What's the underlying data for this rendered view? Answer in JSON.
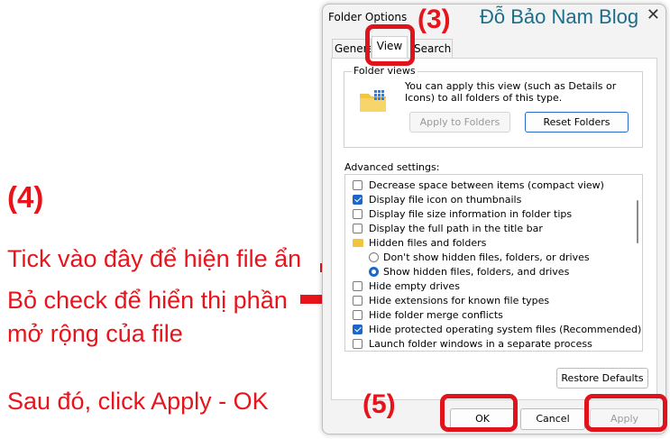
{
  "annotations": {
    "step3": "(3)",
    "step4": "(4)",
    "step5": "(5)",
    "tick": "Tick vào đây để hiện file ẩn",
    "bo_line1": "Bỏ check để hiển thị phần",
    "bo_line2": "mở rộng của file",
    "sau": "Sau đó, click Apply - OK",
    "blog": "Đỗ Bảo Nam Blog"
  },
  "dialog": {
    "title": "Folder Options",
    "close": "✕",
    "tabs": [
      "General",
      "View",
      "Search"
    ],
    "folder_views": {
      "label": "Folder views",
      "text": "You can apply this view (such as Details or Icons) to all folders of this type.",
      "apply_to_folders": "Apply to Folders",
      "reset_folders": "Reset Folders"
    },
    "advanced_label": "Advanced settings:",
    "advanced_items": [
      {
        "label": "Decrease space between items (compact view)",
        "type": "checkbox",
        "checked": false
      },
      {
        "label": "Display file icon on thumbnails",
        "type": "checkbox",
        "checked": true
      },
      {
        "label": "Display file size information in folder tips",
        "type": "checkbox",
        "checked": false
      },
      {
        "label": "Display the full path in the title bar",
        "type": "checkbox",
        "checked": false
      },
      {
        "label": "Hidden files and folders",
        "type": "folder",
        "checked": false
      },
      {
        "label": "Don't show hidden files, folders, or drives",
        "type": "radio",
        "checked": false
      },
      {
        "label": "Show hidden files, folders, and drives",
        "type": "radio",
        "checked": true
      },
      {
        "label": "Hide empty drives",
        "type": "checkbox",
        "checked": false
      },
      {
        "label": "Hide extensions for known file types",
        "type": "checkbox",
        "checked": false
      },
      {
        "label": "Hide folder merge conflicts",
        "type": "checkbox",
        "checked": false
      },
      {
        "label": "Hide protected operating system files (Recommended)",
        "type": "checkbox",
        "checked": true
      },
      {
        "label": "Launch folder windows in a separate process",
        "type": "checkbox",
        "checked": false
      }
    ],
    "restore_defaults": "Restore Defaults",
    "ok": "OK",
    "cancel": "Cancel",
    "apply": "Apply"
  },
  "colors": {
    "annotation_red": "#e8141c",
    "accent_blue": "#1a66c9",
    "blog_teal": "#1a6e8a"
  }
}
